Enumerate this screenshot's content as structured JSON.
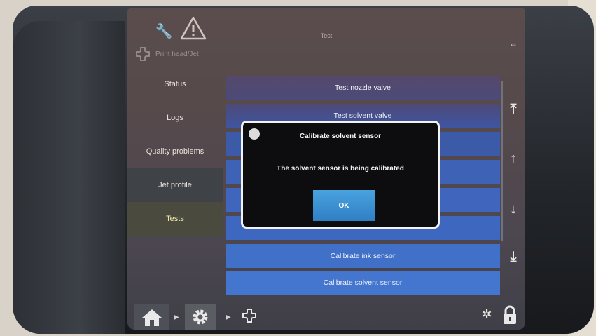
{
  "topbar": {
    "title": "Test",
    "module_label": "Print head/Jet",
    "icons": [
      "wrench-icon",
      "warning-icon",
      "expand-icon",
      "puzzle-icon"
    ]
  },
  "menu": {
    "items": [
      {
        "label": "Status"
      },
      {
        "label": "Logs"
      },
      {
        "label": "Quality problems"
      },
      {
        "label": "Jet profile"
      },
      {
        "label": "Tests"
      }
    ],
    "active_index": 4
  },
  "list": {
    "rows": [
      {
        "label": "Test nozzle valve"
      },
      {
        "label": "Test solvent valve"
      },
      {
        "label": "Calibrate ink sensor"
      },
      {
        "label": "Calibrate solvent sensor"
      }
    ]
  },
  "dialog": {
    "title": "Calibrate solvent sensor",
    "message": "The solvent sensor is being calibrated",
    "ok_label": "OK"
  },
  "bottombar": {
    "icons": [
      "home-icon",
      "gear-icon",
      "puzzle-icon",
      "pulse-icon",
      "lock-icon"
    ]
  },
  "colors": {
    "accent_blue": "#3a8fd3",
    "row_blue": "#3d6fc8",
    "dialog_bg": "#0d0d0f",
    "active_text": "#f3e9a8"
  }
}
